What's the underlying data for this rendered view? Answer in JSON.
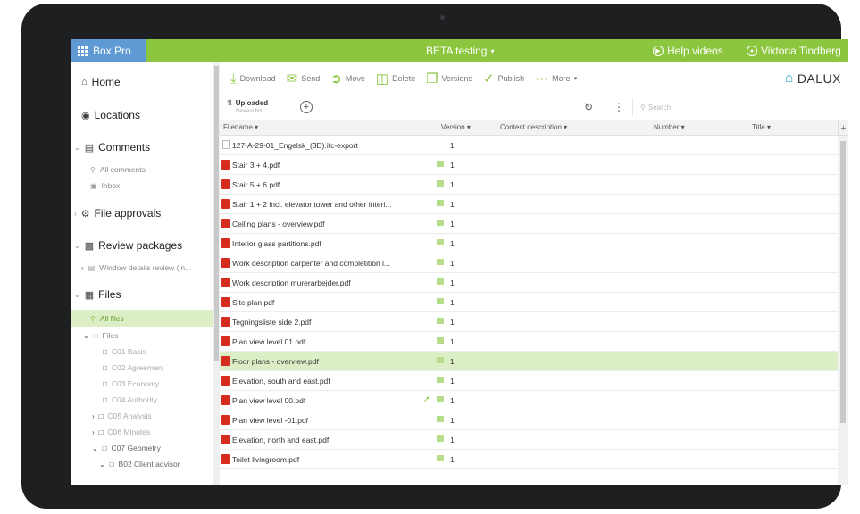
{
  "app": {
    "name": "Box Pro",
    "project": "BETA testing",
    "help": "Help videos",
    "user": "Viktoria Tindberg",
    "brand": "DALUX",
    "accent": "#8cc63f",
    "header_blue": "#5f9ad4"
  },
  "sidebar": {
    "home": "Home",
    "locations": "Locations",
    "comments": "Comments",
    "all_comments": "All comments",
    "inbox": "Inbox",
    "file_approvals": "File approvals",
    "review_packages": "Review packages",
    "window_review": "Window details review (in...",
    "files": "Files",
    "all_files": "All files",
    "files_folder": "Files",
    "folders": [
      "C01 Basis",
      "C02 Agreement",
      "C03 Economy",
      "C04 Authority",
      "C05 Analysis",
      "C06 Minutes",
      "C07 Geometry"
    ],
    "sub_folder": "B02 Client advisor"
  },
  "toolbar": {
    "download": "Download",
    "send": "Send",
    "move": "Move",
    "delete": "Delete",
    "versions": "Versions",
    "publish": "Publish",
    "more": "More"
  },
  "subbar": {
    "uploaded": "Uploaded",
    "uploaded_sub": "Newest first",
    "search_placeholder": "Search"
  },
  "table": {
    "headers": [
      "Filename",
      "Version",
      "Content description",
      "Number",
      "Title"
    ],
    "rows": [
      {
        "name": "127-A-29-01_Engelsk_(3D).ifc-export",
        "version": "1",
        "icon": "text-file-icon"
      },
      {
        "name": "Stair 3 + 4.pdf",
        "version": "1",
        "icon": "pdf-icon"
      },
      {
        "name": "Stair 5 + 6.pdf",
        "version": "1",
        "icon": "pdf-icon"
      },
      {
        "name": "Stair 1 + 2 incl. elevator tower and other interi...",
        "version": "1",
        "icon": "pdf-icon"
      },
      {
        "name": "Ceiling plans - overview.pdf",
        "version": "1",
        "icon": "pdf-icon"
      },
      {
        "name": "Interior glass partitions.pdf",
        "version": "1",
        "icon": "pdf-icon"
      },
      {
        "name": "Work description carpenter and completition l...",
        "version": "1",
        "icon": "pdf-icon"
      },
      {
        "name": "Work description murerarbejder.pdf",
        "version": "1",
        "icon": "pdf-icon"
      },
      {
        "name": "Site plan.pdf",
        "version": "1",
        "icon": "pdf-icon"
      },
      {
        "name": "Tegningsliste side 2.pdf",
        "version": "1",
        "icon": "pdf-icon"
      },
      {
        "name": "Plan view level 01.pdf",
        "version": "1",
        "icon": "pdf-icon"
      },
      {
        "name": "Floor plans - overview.pdf",
        "version": "1",
        "icon": "pdf-icon"
      },
      {
        "name": "Elevation, south and east.pdf",
        "version": "1",
        "icon": "pdf-icon"
      },
      {
        "name": "Plan view level 00.pdf",
        "version": "1",
        "icon": "pdf-icon"
      },
      {
        "name": "Plan view level -01.pdf",
        "version": "1",
        "icon": "pdf-icon"
      },
      {
        "name": "Elevation, north and east.pdf",
        "version": "1",
        "icon": "pdf-icon"
      },
      {
        "name": "Toilet livingroom.pdf",
        "version": "1",
        "icon": "pdf-icon"
      }
    ]
  }
}
